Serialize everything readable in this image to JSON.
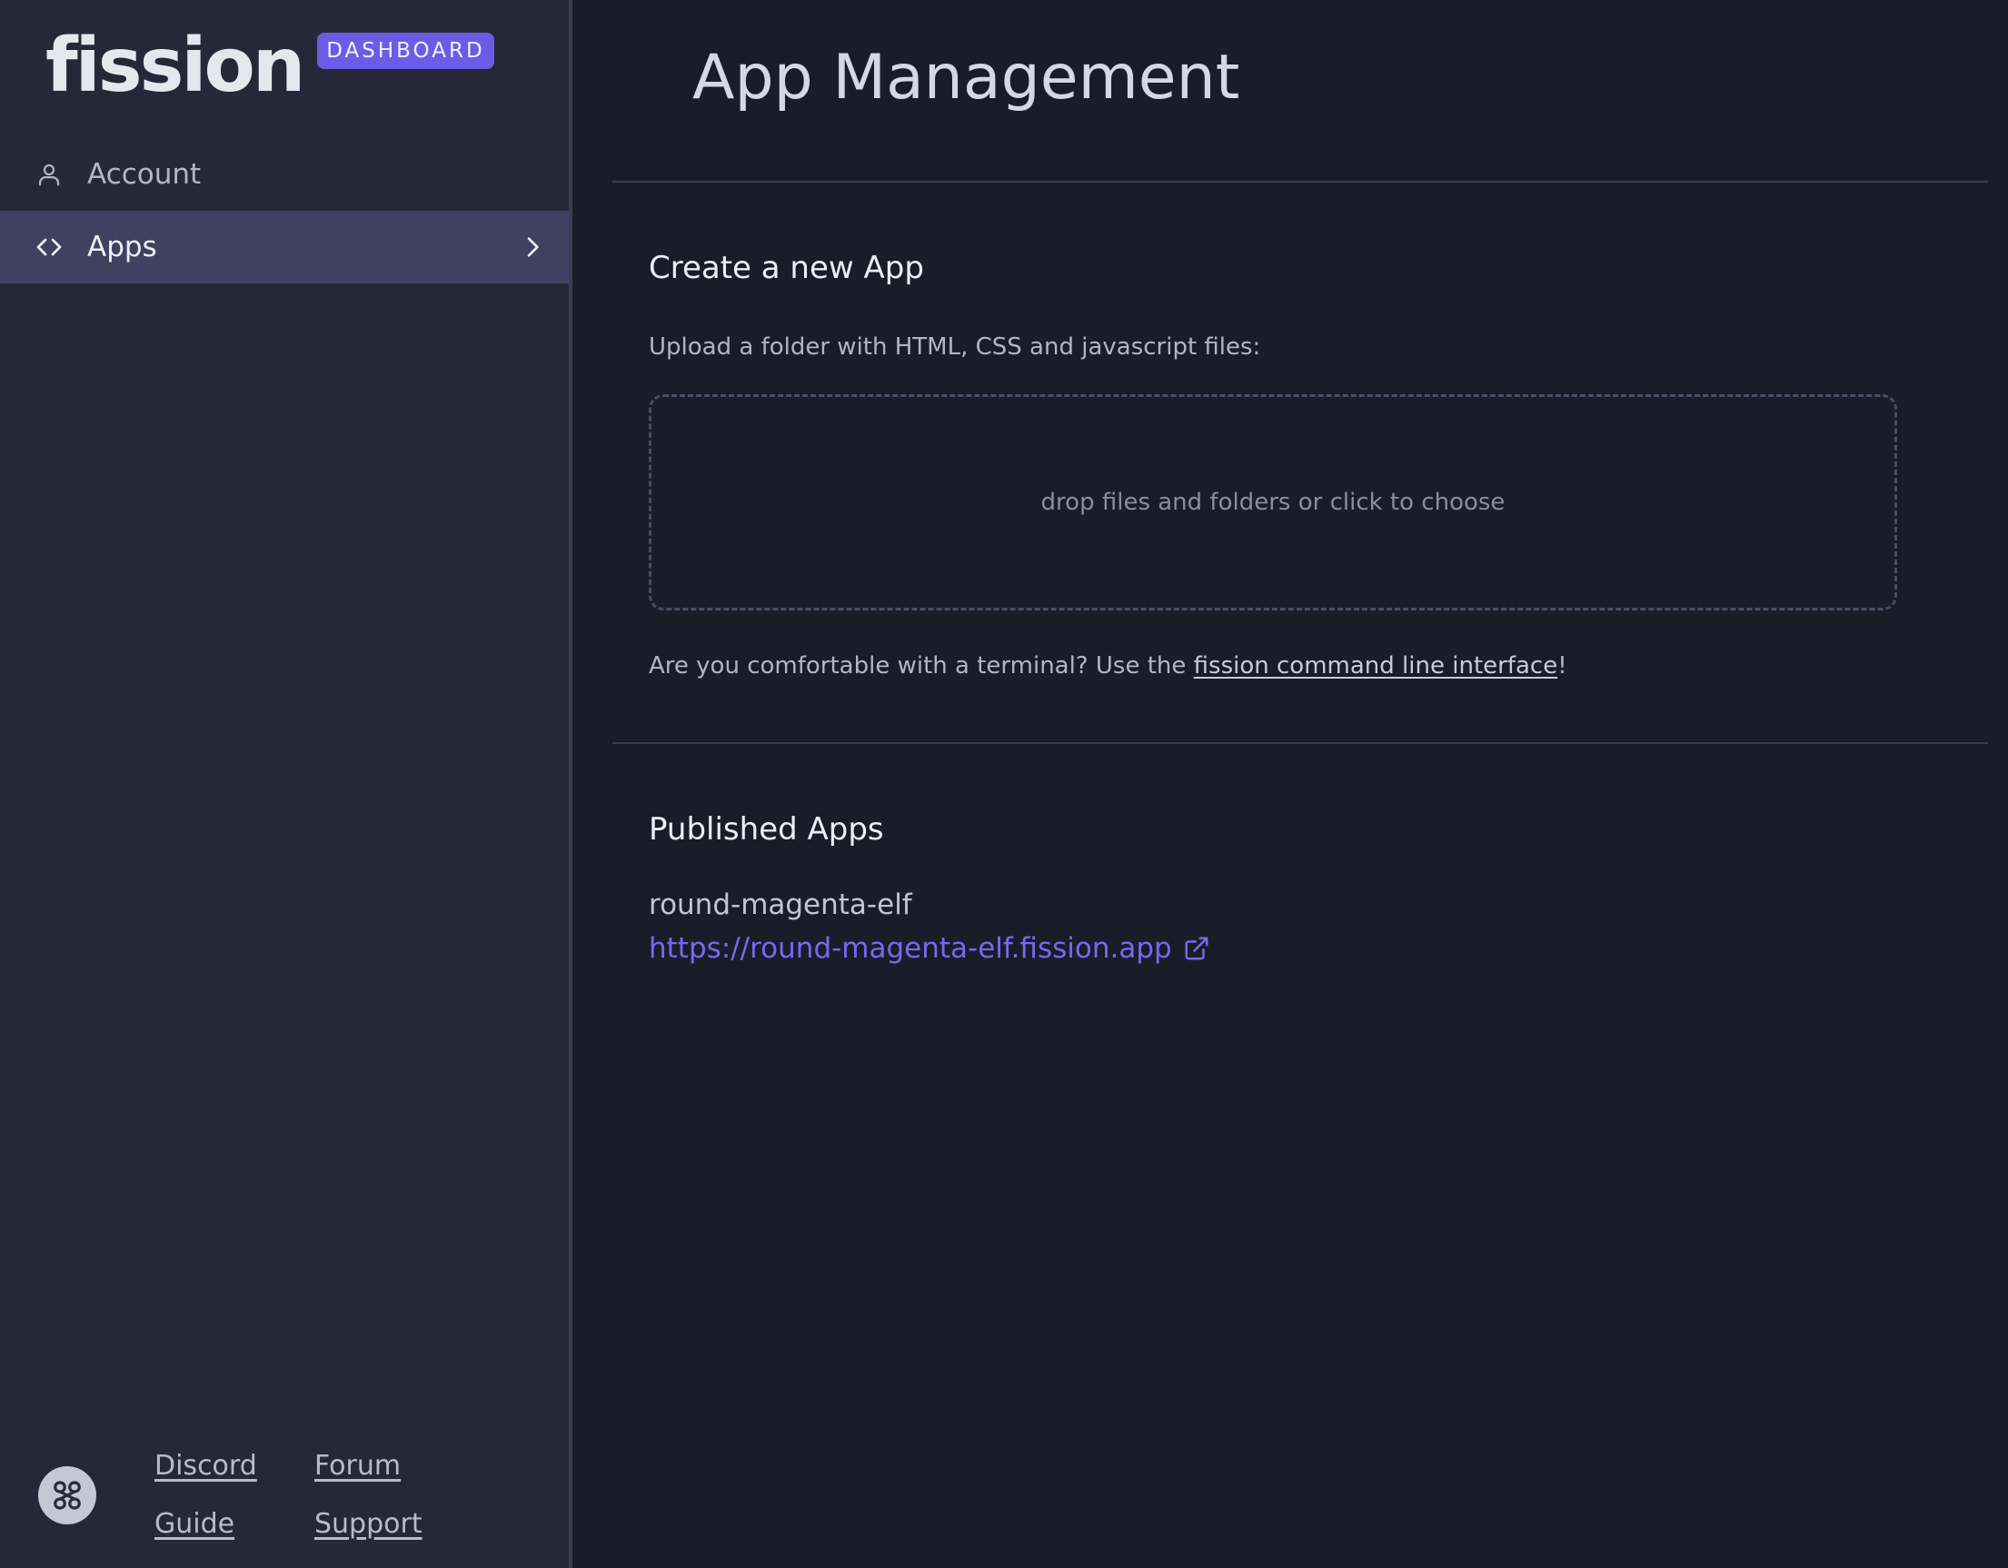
{
  "brand": {
    "name": "fission",
    "badge": "DASHBOARD"
  },
  "sidebar": {
    "items": [
      {
        "label": "Account",
        "icon": "user-icon",
        "active": false
      },
      {
        "label": "Apps",
        "icon": "code-icon",
        "active": true
      }
    ],
    "footer_links": {
      "discord": "Discord",
      "forum": "Forum",
      "guide": "Guide",
      "support": "Support"
    }
  },
  "main": {
    "title": "App Management",
    "create": {
      "heading": "Create a new App",
      "instructions": "Upload a folder with HTML, CSS and javascript files:",
      "dropzone_text": "drop files and folders or click to choose",
      "cli_prefix": "Are you comfortable with a terminal? Use the ",
      "cli_link": "fission command line interface",
      "cli_suffix": "!"
    },
    "published": {
      "heading": "Published Apps",
      "apps": [
        {
          "name": "round-magenta-elf",
          "url": "https://round-magenta-elf.fission.app"
        }
      ]
    }
  },
  "colors": {
    "accent": "#6b5ce7",
    "link": "#7a66f0",
    "sidebar_bg": "#262838",
    "main_bg": "#1a1c28",
    "active_item_bg": "#3f4160"
  }
}
